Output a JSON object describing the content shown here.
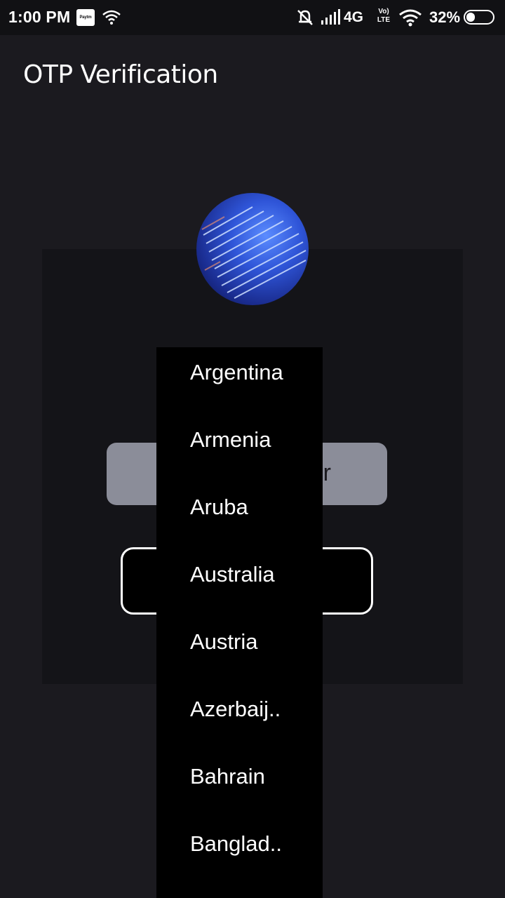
{
  "status_bar": {
    "time": "1:00 PM",
    "paytm_label": "Paytm",
    "network": "4G",
    "volte_top": "Vo)",
    "volte_bottom": "LTE",
    "battery_percent": "32%",
    "battery_level": 0.32,
    "icons": [
      "paytm-icon",
      "wifi-icon",
      "mute-icon",
      "signal-icon",
      "wifi-icon",
      "battery-icon"
    ]
  },
  "toolbar": {
    "title": "OTP Verification"
  },
  "form": {
    "phone_field_visible_text": "r"
  },
  "dropdown": {
    "items": [
      "Argentina",
      "Armenia",
      "Aruba",
      "Australia",
      "Austria",
      "Azerbaij..",
      "Bahrain",
      "Banglad.."
    ]
  },
  "colors": {
    "background": "#1b1a1f",
    "status_bar": "#111114",
    "card": "#141418",
    "phone_field": "#8b8d99",
    "dropdown": "#000000",
    "text": "#ffffff"
  }
}
